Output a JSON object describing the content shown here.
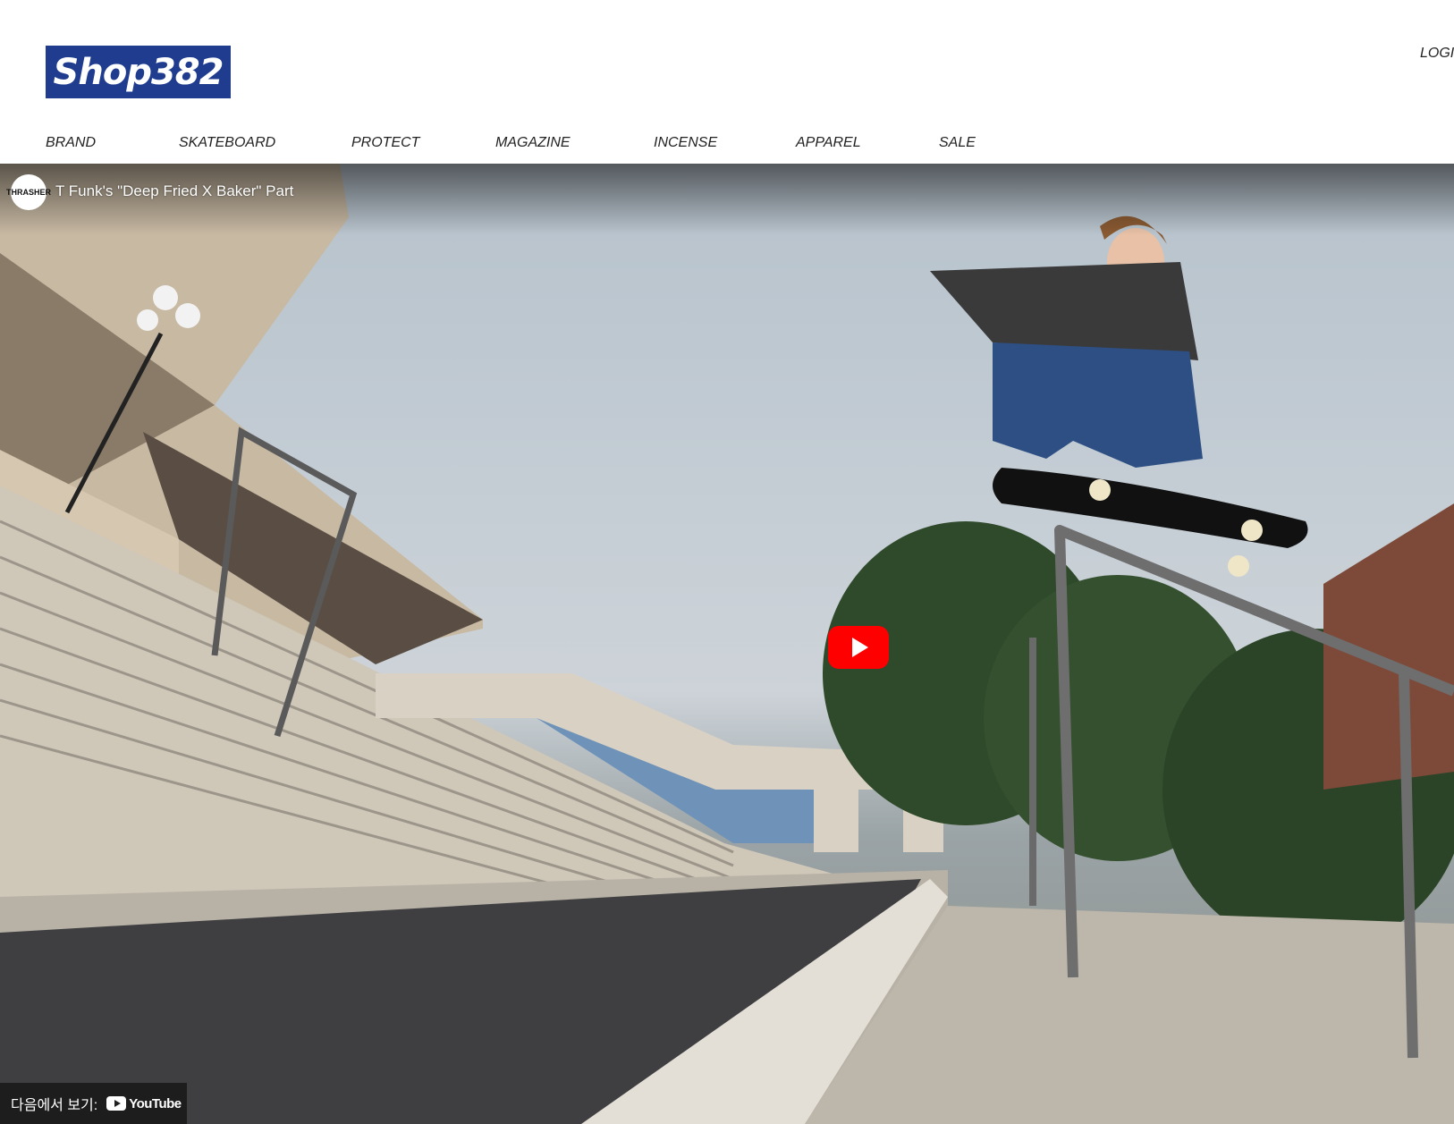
{
  "header": {
    "logo_text": "Shop382",
    "login_label": "LOGIN"
  },
  "nav": {
    "items": [
      "BRAND",
      "SKATEBOARD",
      "PROTECT",
      "MAGAZINE",
      "INCENSE",
      "APPAREL",
      "SALE"
    ]
  },
  "video": {
    "title": "T Funk's \"Deep Fried X Baker\" Part",
    "channel_avatar_text": "THRASHER",
    "watch_on_label": "다음에서 보기:",
    "youtube_word": "YouTube",
    "play_icon": "play-icon"
  },
  "colors": {
    "logo_bg": "#1f3c8f",
    "play_button": "#ff0000"
  }
}
